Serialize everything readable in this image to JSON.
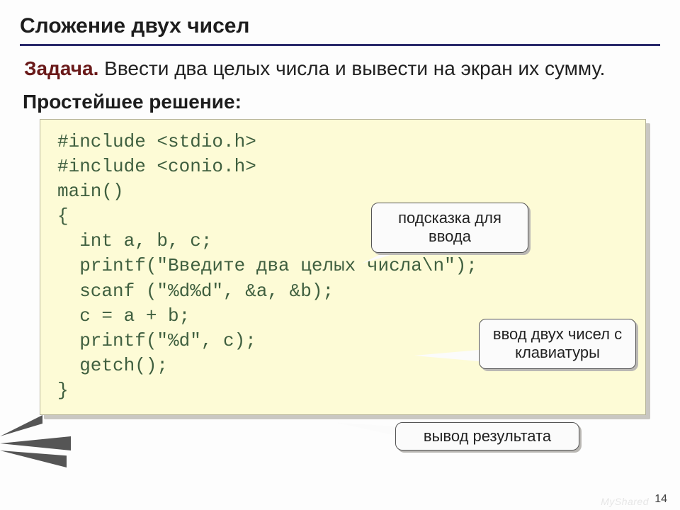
{
  "title": "Сложение двух чисел",
  "task": {
    "label": "Задача.",
    "text": " Ввести два целых числа и вывести на экран их сумму."
  },
  "subheader": "Простейшее решение:",
  "code": "#include <stdio.h>\n#include <conio.h>\nmain()\n{\n  int a, b, c;\n  printf(\"Введите два целых числа\\n\");\n  scanf (\"%d%d\", &a, &b);\n  c = a + b;\n  printf(\"%d\", c);\n  getch();\n}",
  "callouts": {
    "hint": "подсказка для ввода",
    "input": "ввод двух чисел с клавиатуры",
    "output": "вывод результата"
  },
  "page_number": "14",
  "watermark": "MyShared"
}
